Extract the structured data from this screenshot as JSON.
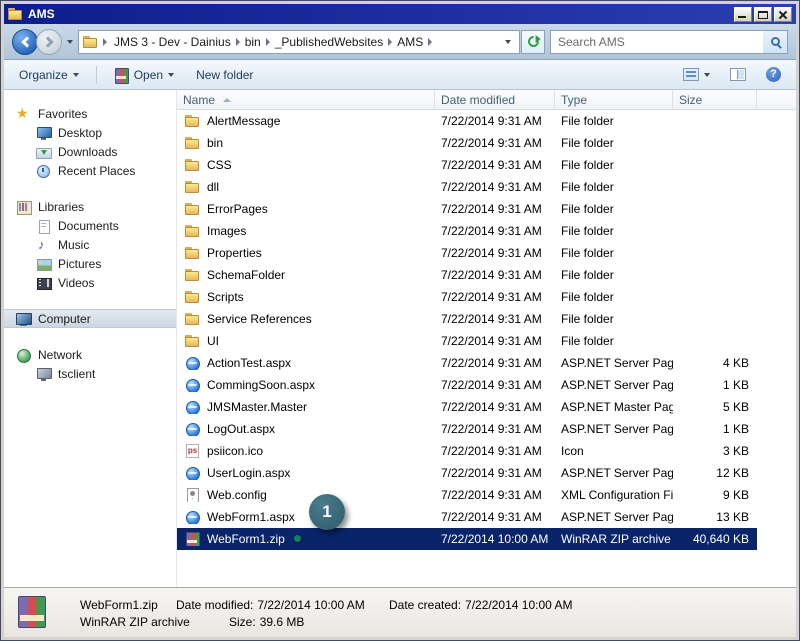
{
  "window": {
    "title": "AMS"
  },
  "address": {
    "segments": [
      "JMS 3 - Dev - Dainius",
      "bin",
      "_PublishedWebsites",
      "AMS"
    ],
    "search_value": "Search AMS"
  },
  "toolbar": {
    "organize_label": "Organize",
    "open_label": "Open",
    "new_folder_label": "New folder",
    "help_glyph": "?"
  },
  "sidebar": {
    "sections": [
      {
        "label": "Favorites",
        "icon": "favorites-star",
        "selected": false,
        "children": [
          {
            "label": "Desktop",
            "icon": "desktop"
          },
          {
            "label": "Downloads",
            "icon": "downloads"
          },
          {
            "label": "Recent Places",
            "icon": "recent-places"
          }
        ]
      },
      {
        "label": "Libraries",
        "icon": "libraries",
        "selected": false,
        "children": [
          {
            "label": "Documents",
            "icon": "documents"
          },
          {
            "label": "Music",
            "icon": "music"
          },
          {
            "label": "Pictures",
            "icon": "pictures"
          },
          {
            "label": "Videos",
            "icon": "videos"
          }
        ]
      },
      {
        "label": "Computer",
        "icon": "computer",
        "selected": true,
        "children": []
      },
      {
        "label": "Network",
        "icon": "network",
        "selected": false,
        "children": [
          {
            "label": "tsclient",
            "icon": "tsclient"
          }
        ]
      }
    ]
  },
  "list": {
    "columns": [
      {
        "label": "Name",
        "sorted": "asc"
      },
      {
        "label": "Date modified"
      },
      {
        "label": "Type"
      },
      {
        "label": "Size"
      }
    ],
    "rows": [
      {
        "name": "AlertMessage",
        "modified": "7/22/2014 9:31 AM",
        "type": "File folder",
        "size": "",
        "icon": "folder",
        "selected": false
      },
      {
        "name": "bin",
        "modified": "7/22/2014 9:31 AM",
        "type": "File folder",
        "size": "",
        "icon": "folder",
        "selected": false
      },
      {
        "name": "CSS",
        "modified": "7/22/2014 9:31 AM",
        "type": "File folder",
        "size": "",
        "icon": "folder",
        "selected": false
      },
      {
        "name": "dll",
        "modified": "7/22/2014 9:31 AM",
        "type": "File folder",
        "size": "",
        "icon": "folder",
        "selected": false
      },
      {
        "name": "ErrorPages",
        "modified": "7/22/2014 9:31 AM",
        "type": "File folder",
        "size": "",
        "icon": "folder",
        "selected": false
      },
      {
        "name": "Images",
        "modified": "7/22/2014 9:31 AM",
        "type": "File folder",
        "size": "",
        "icon": "folder",
        "selected": false
      },
      {
        "name": "Properties",
        "modified": "7/22/2014 9:31 AM",
        "type": "File folder",
        "size": "",
        "icon": "folder",
        "selected": false
      },
      {
        "name": "SchemaFolder",
        "modified": "7/22/2014 9:31 AM",
        "type": "File folder",
        "size": "",
        "icon": "folder",
        "selected": false
      },
      {
        "name": "Scripts",
        "modified": "7/22/2014 9:31 AM",
        "type": "File folder",
        "size": "",
        "icon": "folder",
        "selected": false
      },
      {
        "name": "Service References",
        "modified": "7/22/2014 9:31 AM",
        "type": "File folder",
        "size": "",
        "icon": "folder",
        "selected": false
      },
      {
        "name": "UI",
        "modified": "7/22/2014 9:31 AM",
        "type": "File folder",
        "size": "",
        "icon": "folder",
        "selected": false
      },
      {
        "name": "ActionTest.aspx",
        "modified": "7/22/2014 9:31 AM",
        "type": "ASP.NET Server Page",
        "size": "4 KB",
        "icon": "aspx",
        "selected": false
      },
      {
        "name": "CommingSoon.aspx",
        "modified": "7/22/2014 9:31 AM",
        "type": "ASP.NET Server Page",
        "size": "1 KB",
        "icon": "aspx",
        "selected": false
      },
      {
        "name": "JMSMaster.Master",
        "modified": "7/22/2014 9:31 AM",
        "type": "ASP.NET Master Page",
        "size": "5 KB",
        "icon": "master",
        "selected": false
      },
      {
        "name": "LogOut.aspx",
        "modified": "7/22/2014 9:31 AM",
        "type": "ASP.NET Server Page",
        "size": "1 KB",
        "icon": "aspx",
        "selected": false
      },
      {
        "name": "psiicon.ico",
        "modified": "7/22/2014 9:31 AM",
        "type": "Icon",
        "size": "3 KB",
        "icon": "ico",
        "selected": false
      },
      {
        "name": "UserLogin.aspx",
        "modified": "7/22/2014 9:31 AM",
        "type": "ASP.NET Server Page",
        "size": "12 KB",
        "icon": "aspx",
        "selected": false
      },
      {
        "name": "Web.config",
        "modified": "7/22/2014 9:31 AM",
        "type": "XML Configuration File",
        "size": "9 KB",
        "icon": "config",
        "selected": false
      },
      {
        "name": "WebForm1.aspx",
        "modified": "7/22/2014 9:31 AM",
        "type": "ASP.NET Server Page",
        "size": "13 KB",
        "icon": "aspx",
        "selected": false
      },
      {
        "name": "WebForm1.zip",
        "modified": "7/22/2014 10:00 AM",
        "type": "WinRAR ZIP archive",
        "size": "40,640 KB",
        "icon": "winrar",
        "selected": true
      }
    ]
  },
  "callout": {
    "label": "1"
  },
  "statusbar": {
    "file_name": "WebForm1.zip",
    "file_type": "WinRAR ZIP archive",
    "date_modified_label": "Date modified:",
    "date_modified": "7/22/2014 10:00 AM",
    "size_label": "Size:",
    "size_value": "39.6 MB",
    "date_created_label": "Date created:",
    "date_created": "7/22/2014 10:00 AM"
  }
}
